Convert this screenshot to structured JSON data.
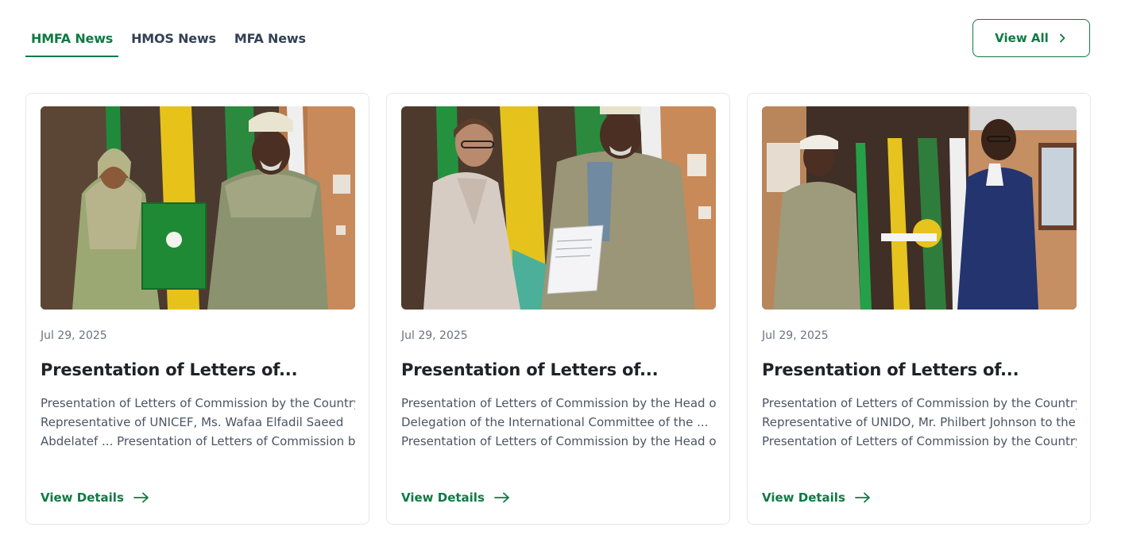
{
  "tabs": [
    {
      "label": "HMFA News",
      "active": true
    },
    {
      "label": "HMOS News",
      "active": false
    },
    {
      "label": "MFA News",
      "active": false
    }
  ],
  "view_all_label": "View All",
  "accent_color": "#0f7a43",
  "cards": [
    {
      "date": "Jul 29, 2025",
      "title": "Presentation of Letters of...",
      "excerpt_lines": [
        "Presentation of Letters of Commission by the Country",
        "Representative of UNICEF, Ms. Wafaa Elfadil Saeed",
        "Abdelatef ... Presentation of Letters of Commission by..."
      ],
      "details_label": "View Details"
    },
    {
      "date": "Jul 29, 2025",
      "title": "Presentation of Letters of...",
      "excerpt_lines": [
        "Presentation of Letters of Commission by the Head of",
        "Delegation of the International Committee of the ...",
        "Presentation of Letters of Commission by the Head of..."
      ],
      "details_label": "View Details"
    },
    {
      "date": "Jul 29, 2025",
      "title": "Presentation of Letters of...",
      "excerpt_lines": [
        "Presentation of Letters of Commission by the Country",
        "Representative of UNIDO, Mr. Philbert Johnson to the ...",
        "Presentation of Letters of Commission by the Country..."
      ],
      "details_label": "View Details"
    }
  ]
}
